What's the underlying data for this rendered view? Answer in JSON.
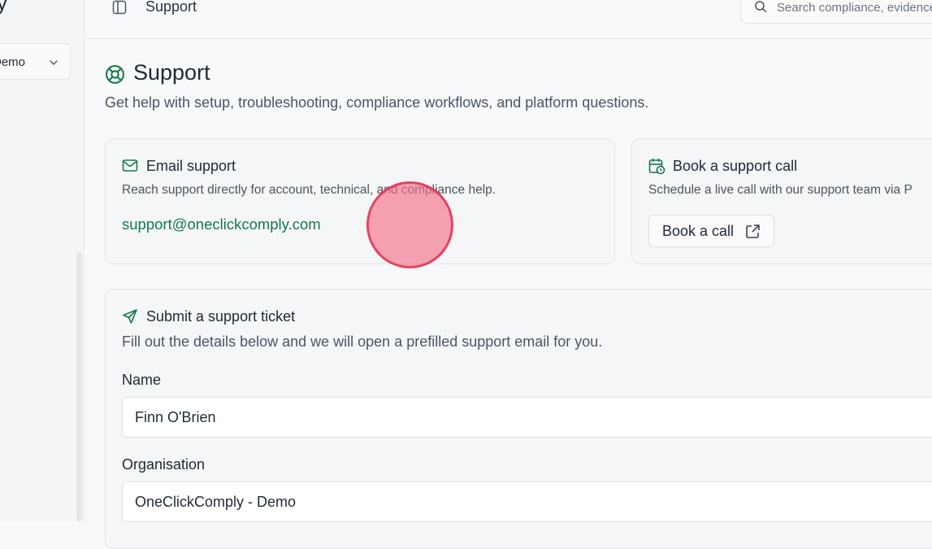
{
  "sidebar": {
    "brand_fragment": "y",
    "org_switcher_label": "Demo"
  },
  "topbar": {
    "title": "Support",
    "search_placeholder": "Search compliance, evidence..."
  },
  "page": {
    "title": "Support",
    "subtitle": "Get help with setup, troubleshooting, compliance workflows, and platform questions."
  },
  "email_card": {
    "title": "Email support",
    "description": "Reach support directly for account, technical, and compliance help.",
    "email": "support@oneclickcomply.com"
  },
  "call_card": {
    "title": "Book a support call",
    "description": "Schedule a live call with our support team via P",
    "button_label": "Book a call"
  },
  "ticket_card": {
    "title": "Submit a support ticket",
    "description": "Fill out the details below and we will open a prefilled support email for you.",
    "name_label": "Name",
    "name_value": "Finn O'Brien",
    "org_label": "Organisation",
    "org_value": "OneClickComply - Demo"
  },
  "colors": {
    "accent": "#137a4a",
    "background": "#f8f9fa",
    "card": "#f5f6f7",
    "cursor": "#f4728c"
  }
}
